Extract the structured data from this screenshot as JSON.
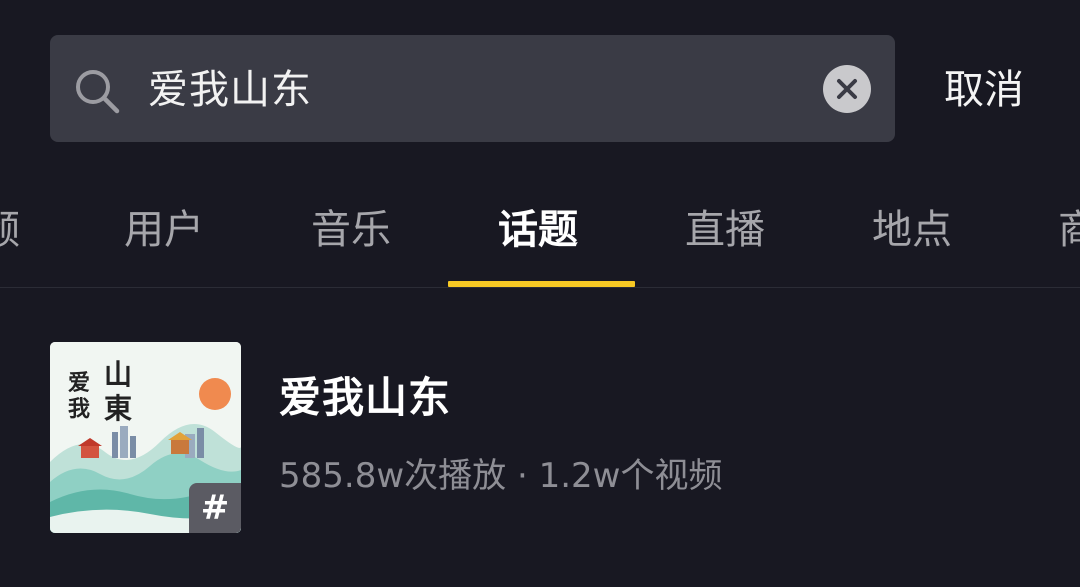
{
  "search": {
    "query": "爱我山东",
    "cancel_label": "取消"
  },
  "tabs": [
    {
      "label": "频",
      "active": false
    },
    {
      "label": "用户",
      "active": false
    },
    {
      "label": "音乐",
      "active": false
    },
    {
      "label": "话题",
      "active": true
    },
    {
      "label": "直播",
      "active": false
    },
    {
      "label": "地点",
      "active": false
    },
    {
      "label": "商",
      "active": false
    }
  ],
  "result": {
    "title": "爱我山东",
    "plays": "585.8w次播放",
    "separator": "·",
    "videos": "1.2w个视频",
    "thumbnail": {
      "text_left": "爱我",
      "text_right": "山東",
      "badge": "#"
    }
  },
  "colors": {
    "background": "#181822",
    "search_box": "#3a3b45",
    "active_indicator": "#f6c824",
    "inactive_tab": "#a6a6ab",
    "secondary_text": "#8e8e95"
  }
}
